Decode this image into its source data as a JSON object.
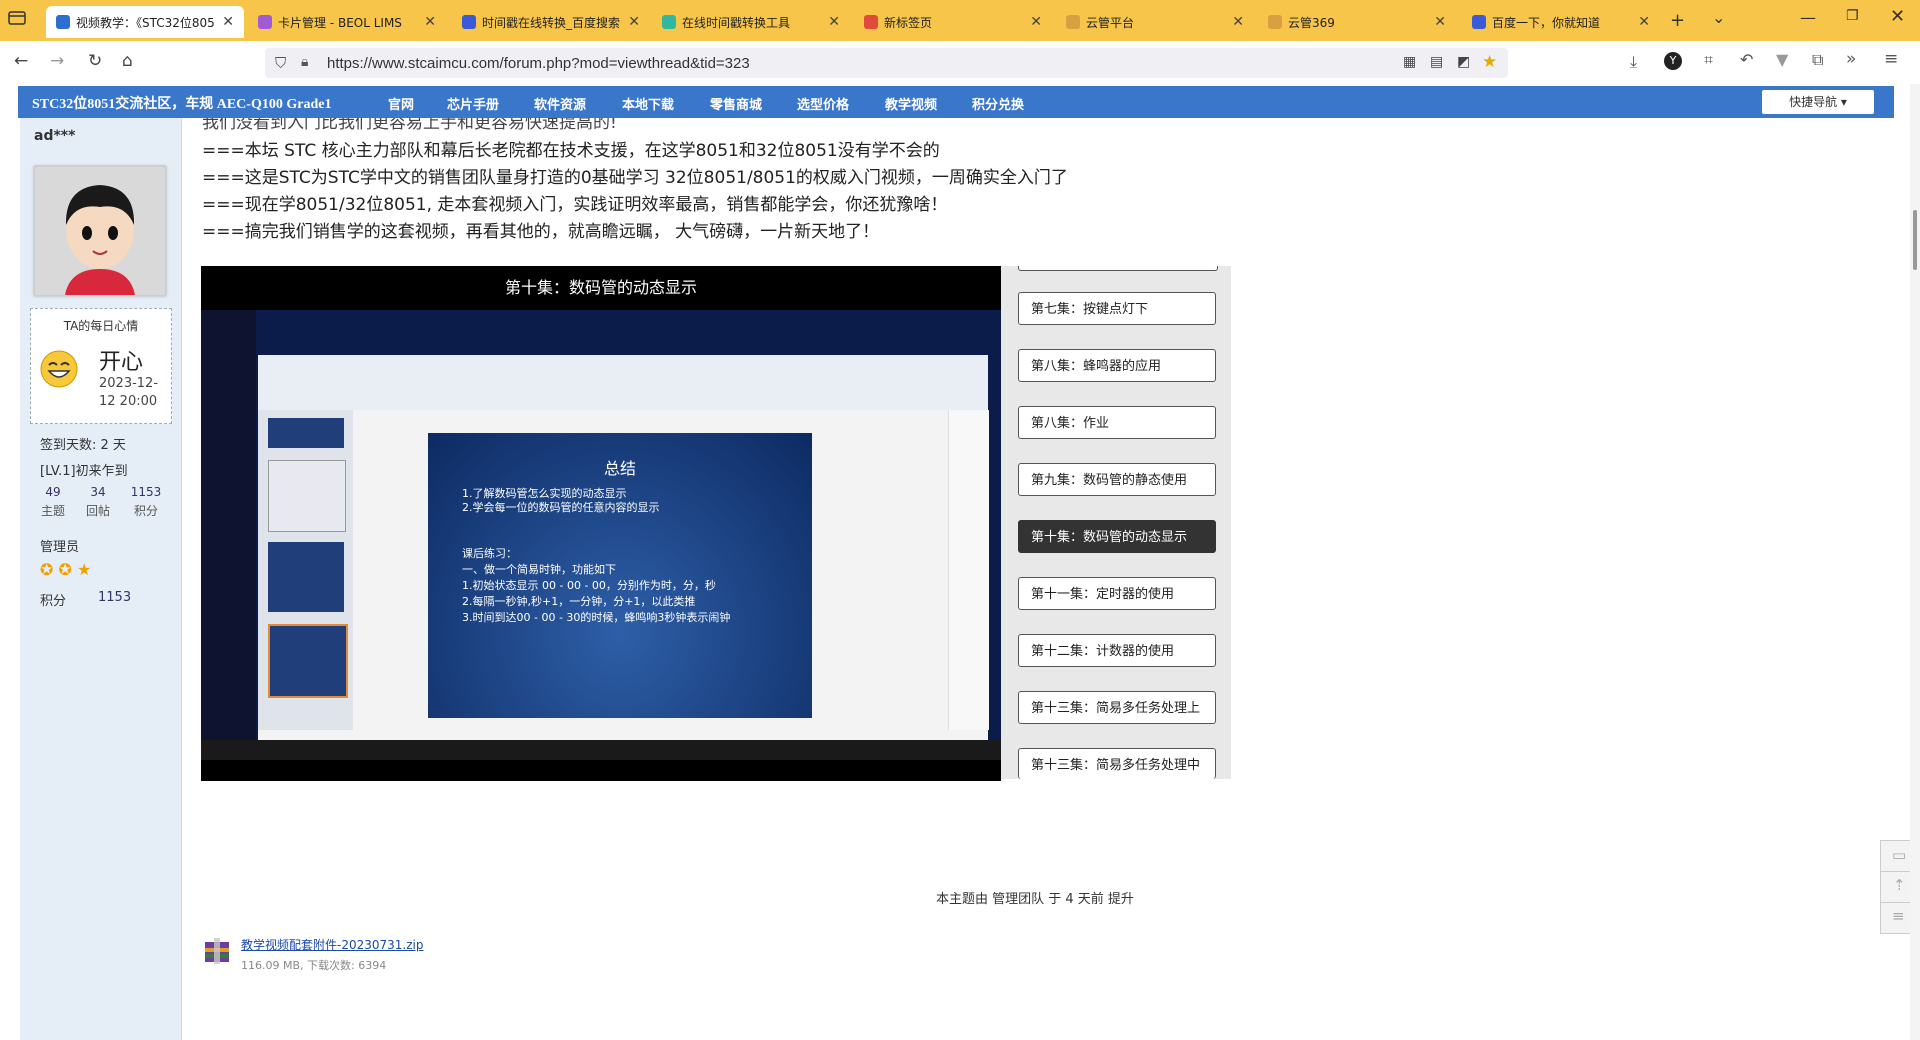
{
  "tabs": [
    {
      "title": "视频教学：《STC32位805",
      "color": "#2c6fd1",
      "active": true
    },
    {
      "title": "卡片管理 - BEOL LIMS",
      "color": "#a05ad6",
      "active": false
    },
    {
      "title": "时间戳在线转换_百度搜索",
      "color": "#3a5bd6",
      "active": false
    },
    {
      "title": "在线时间戳转换工具",
      "color": "#2fb7a0",
      "active": false
    },
    {
      "title": "新标签页",
      "color": "#e04a3a",
      "active": false
    },
    {
      "title": "云管平台",
      "color": "#d8a040",
      "active": false
    },
    {
      "title": "云管369",
      "color": "#d8a040",
      "active": false
    },
    {
      "title": "百度一下，你就知道",
      "color": "#3a5bd6",
      "active": false
    }
  ],
  "browser": {
    "url": "https://www.stcaimcu.com/forum.php?mod=viewthread&tid=323"
  },
  "forum": {
    "site_name": "STC32位8051交流社区，车规 AEC-Q100 Grade1",
    "nav": [
      "官网",
      "芯片手册",
      "软件资源",
      "本地下载",
      "零售商城",
      "选型价格",
      "教学视频",
      "积分兑换"
    ],
    "quick_nav": "快捷导航"
  },
  "user": {
    "name": "ad***",
    "mood_label": "TA的每日心情",
    "mood": "开心",
    "mood_date": "2023-12-12 20:00",
    "signin": "签到天数: 2 天",
    "level": "[LV.1]初来乍到",
    "stats": [
      {
        "value": "49",
        "label": "主题"
      },
      {
        "value": "34",
        "label": "回帖"
      },
      {
        "value": "1153",
        "label": "积分"
      }
    ],
    "group": "管理员",
    "points_label": "积分",
    "points_value": "1153"
  },
  "post": {
    "lines": [
      "我们没看到入门比我们更容易上手和更容易快速提高的!",
      "===本坛 STC  核心主力部队和幕后长老院都在技术支援，在这学8051和32位8051没有学不会的",
      "===这是STC为STC学中文的销售团队量身打造的0基础学习 32位8051/8051的权威入门视频，一周确实全入门了",
      "===现在学8051/32位8051, 走本套视频入门，实践证明效率最高，销售都能学会，你还犹豫啥！",
      "===搞完我们销售学的这套视频，再看其他的，就高瞻远瞩，  大气磅礴，一片新天地了！"
    ],
    "video_title": "第十集：数码管的动态显示",
    "slide_title": "总结",
    "slide_lines": [
      "1.了解数码管怎么实现的动态显示",
      "2.学会每一位的数码管的任意内容的显示",
      "课后练习：",
      "一、做一个简易时钟，功能如下",
      "1.初始状态显示 00 - 00 - 00，分别作为时，分，秒",
      "2.每隔一秒钟,秒+1，一分钟，分+1，以此类推",
      "3.时间到达00 - 00 - 30的时候，蜂鸣响3秒钟表示闹钟"
    ],
    "episodes": [
      {
        "label": "第七集：按键点灯下",
        "current": false
      },
      {
        "label": "第八集：蜂鸣器的应用",
        "current": false
      },
      {
        "label": "第八集：作业",
        "current": false
      },
      {
        "label": "第九集：数码管的静态使用",
        "current": false
      },
      {
        "label": "第十集：数码管的动态显示",
        "current": true
      },
      {
        "label": "第十一集：定时器的使用",
        "current": false
      },
      {
        "label": "第十二集：计数器的使用",
        "current": false
      },
      {
        "label": "第十三集：简易多任务处理上",
        "current": false
      },
      {
        "label": "第十三集：简易多任务处理中",
        "current": false
      }
    ],
    "bump_note": "本主题由 管理团队 于 4 天前 提升",
    "attachment_name": "教学视频配套附件-20230731.zip",
    "attachment_info": "116.09 MB, 下载次数: 6394"
  }
}
